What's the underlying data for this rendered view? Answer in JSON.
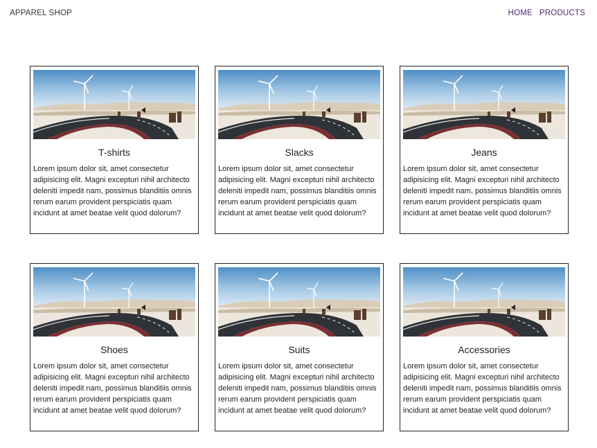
{
  "header": {
    "brand": "APPAREL SHOP",
    "nav": [
      {
        "label": "HOME"
      },
      {
        "label": "PRODUCTS"
      }
    ]
  },
  "products": [
    {
      "title": "T-shirts",
      "description": "Lorem ipsum dolor sit, amet consectetur adipisicing elit. Magni excepturi nihil architecto deleniti impedit nam, possimus blanditiis omnis rerum earum provident perspiciatis quam incidunt at amet beatae velit quod dolorum?"
    },
    {
      "title": "Slacks",
      "description": "Lorem ipsum dolor sit, amet consectetur adipisicing elit. Magni excepturi nihil architecto deleniti impedit nam, possimus blanditiis omnis rerum earum provident perspiciatis quam incidunt at amet beatae velit quod dolorum?"
    },
    {
      "title": "Jeans",
      "description": "Lorem ipsum dolor sit, amet consectetur adipisicing elit. Magni excepturi nihil architecto deleniti impedit nam, possimus blanditiis omnis rerum earum provident perspiciatis quam incidunt at amet beatae velit quod dolorum?"
    },
    {
      "title": "Shoes",
      "description": "Lorem ipsum dolor sit, amet consectetur adipisicing elit. Magni excepturi nihil architecto deleniti impedit nam, possimus blanditiis omnis rerum earum provident perspiciatis quam incidunt at amet beatae velit quod dolorum?"
    },
    {
      "title": "Suits",
      "description": "Lorem ipsum dolor sit, amet consectetur adipisicing elit. Magni excepturi nihil architecto deleniti impedit nam, possimus blanditiis omnis rerum earum provident perspiciatis quam incidunt at amet beatae velit quod dolorum?"
    },
    {
      "title": "Accessories",
      "description": "Lorem ipsum dolor sit, amet consectetur adipisicing elit. Magni excepturi nihil architecto deleniti impedit nam, possimus blanditiis omnis rerum earum provident perspiciatis quam incidunt at amet beatae velit quod dolorum?"
    }
  ],
  "colors": {
    "nav_link": "#4b2a6b",
    "card_border": "#222222",
    "sky_top": "#4f8fc6",
    "sky_bottom": "#d6e6f2",
    "road": "#2f3236"
  }
}
